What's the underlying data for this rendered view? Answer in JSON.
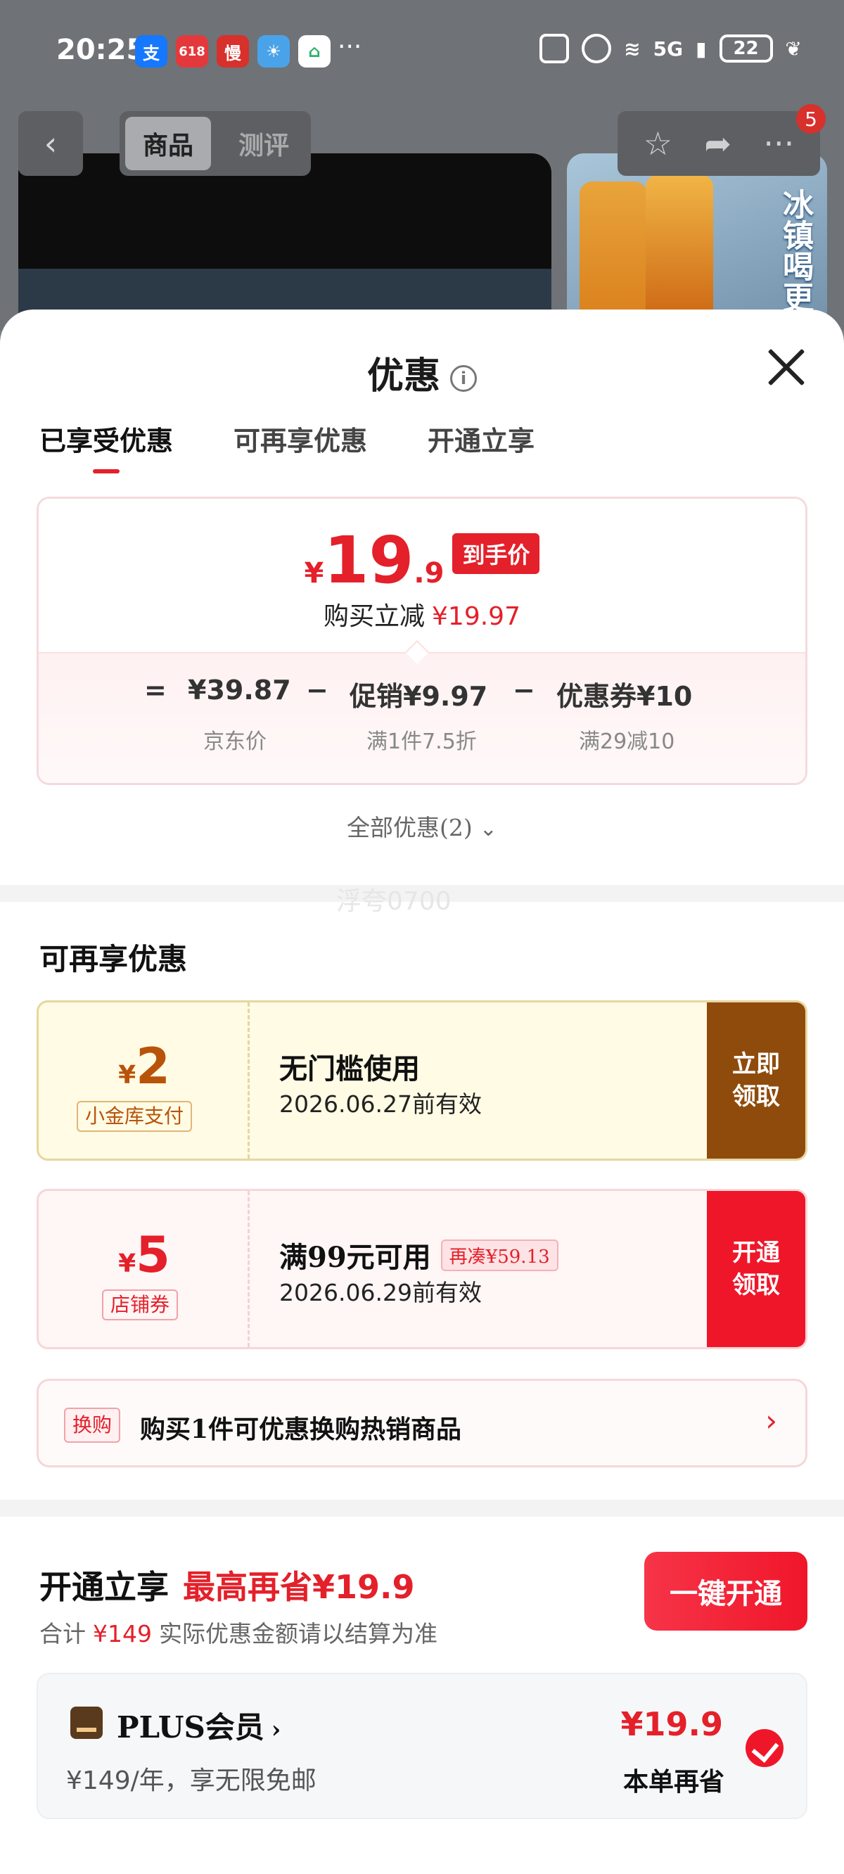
{
  "status_bar": {
    "time": "20:25",
    "network": "5G",
    "battery": "22",
    "apps": [
      {
        "icon": "alipay-icon",
        "glyph": "支",
        "color": "#1677ff"
      },
      {
        "icon": "jd-618-icon",
        "glyph": "618",
        "color": "#e4393c"
      },
      {
        "icon": "app-red-icon",
        "glyph": "慢",
        "color": "#d8302b"
      },
      {
        "icon": "weather-icon",
        "glyph": "☀",
        "color": "#4aa3e8"
      },
      {
        "icon": "home-app-icon",
        "glyph": "⌂",
        "color": "#2bb36a"
      }
    ],
    "more": "···"
  },
  "nav": {
    "tabs": [
      "商品",
      "测评"
    ],
    "badge": "5"
  },
  "product_image": {
    "text": "冰镇喝更"
  },
  "sheet": {
    "title": "优惠",
    "tabs": [
      "已享受优惠",
      "可再享优惠",
      "开通立享"
    ],
    "price": {
      "currency": "¥",
      "integer": "19",
      "decimal": ".9",
      "tag": "到手价",
      "reduce_label": "购买立减",
      "reduce_value": "¥19.97"
    },
    "formula": {
      "eq": "=",
      "jd_price": "¥39.87",
      "minus1": "−",
      "promo": "促销¥9.97",
      "minus2": "−",
      "coupon": "优惠券¥10",
      "jd_price_label": "京东价",
      "promo_label": "满1件7.5折",
      "coupon_label": "满29减10"
    },
    "all_offers": "全部优惠(2)",
    "watermark": "浮夸0700",
    "more_title": "可再享优惠",
    "coupons": [
      {
        "currency": "¥",
        "amount": "2",
        "label": "小金库支付",
        "title": "无门槛使用",
        "date": "2026.06.27前有效",
        "button": "立即领取",
        "extra": ""
      },
      {
        "currency": "¥",
        "amount": "5",
        "label": "店铺券",
        "title": "满99元可用",
        "date": "2026.06.29前有效",
        "button": "开通领取",
        "extra": "再凑¥59.13"
      }
    ],
    "swap": {
      "tag": "换购",
      "text": "购买1件可优惠换购热销商品"
    },
    "open": {
      "title": "开通立享",
      "highlight": "最高再省¥19.9",
      "sub_prefix": "合计",
      "sub_amount": "¥149",
      "sub_suffix": "实际优惠金额请以结算为准",
      "button": "一键开通"
    },
    "plus": {
      "name": "PLUS会员",
      "desc": "¥149/年，享无限免邮",
      "amount": "¥19.9",
      "save_label": "本单再省"
    }
  }
}
